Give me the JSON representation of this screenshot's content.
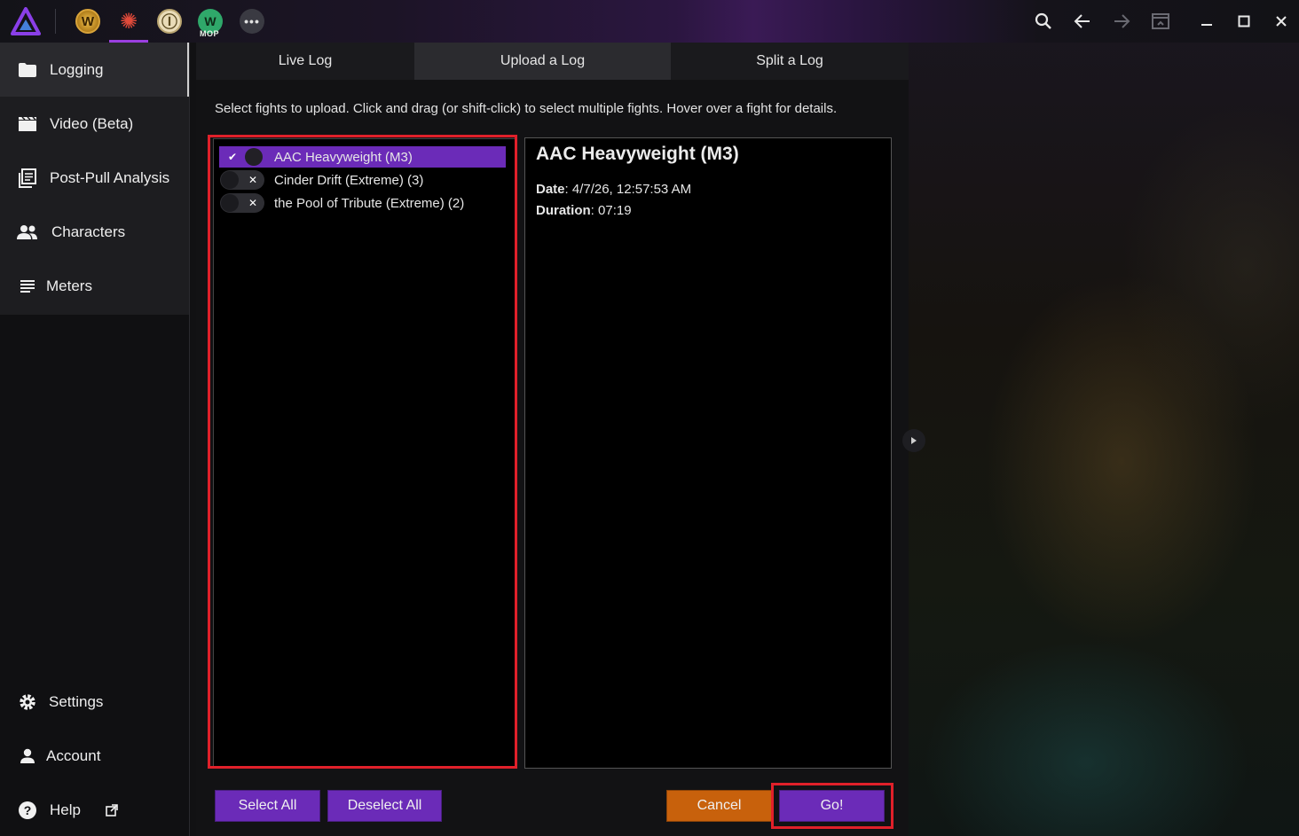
{
  "colors": {
    "accent": "#6b2bb8",
    "cancel": "#c8610c",
    "highlight": "#e0202a"
  },
  "topbar": {
    "games": [
      {
        "name": "wow-icon",
        "glyph": "W"
      },
      {
        "name": "ffxiv-icon",
        "glyph": "✺"
      },
      {
        "name": "eso-icon",
        "glyph": "Ⓘ"
      },
      {
        "name": "mop-icon",
        "glyph": "W",
        "label": "MOP"
      },
      {
        "name": "more-games-icon",
        "glyph": "•••"
      }
    ],
    "right_icons": [
      "search-icon",
      "back-arrow-icon",
      "forward-arrow-icon",
      "popout-icon",
      "minimize-icon",
      "maximize-icon",
      "close-icon"
    ]
  },
  "sidebar": {
    "items": [
      {
        "label": "Logging",
        "icon": "folder-icon"
      },
      {
        "label": "Video (Beta)",
        "icon": "video-icon"
      },
      {
        "label": "Post-Pull Analysis",
        "icon": "analysis-icon"
      },
      {
        "label": "Characters",
        "icon": "characters-icon"
      },
      {
        "label": "Meters",
        "icon": "meters-icon"
      }
    ],
    "bottom": [
      {
        "label": "Settings",
        "icon": "gear-icon"
      },
      {
        "label": "Account",
        "icon": "person-icon"
      },
      {
        "label": "Help",
        "icon": "help-icon"
      }
    ]
  },
  "tabs": [
    {
      "label": "Live Log"
    },
    {
      "label": "Upload a Log"
    },
    {
      "label": "Split a Log"
    }
  ],
  "instructions": "Select fights to upload. Click and drag (or shift-click) to select multiple fights. Hover over a fight for details.",
  "fights": [
    {
      "name": "AAC Heavyweight (M3)",
      "selected": true
    },
    {
      "name": "Cinder Drift (Extreme) (3)",
      "selected": false
    },
    {
      "name": "the Pool of Tribute (Extreme) (2)",
      "selected": false
    }
  ],
  "details": {
    "title": "AAC Heavyweight (M3)",
    "date_label": "Date",
    "date_value": ": 4/7/26, 12:57:53 AM",
    "duration_label": "Duration",
    "duration_value": ": 07:19"
  },
  "buttons": {
    "select_all": "Select All",
    "deselect_all": "Deselect All",
    "cancel": "Cancel",
    "go": "Go!"
  }
}
